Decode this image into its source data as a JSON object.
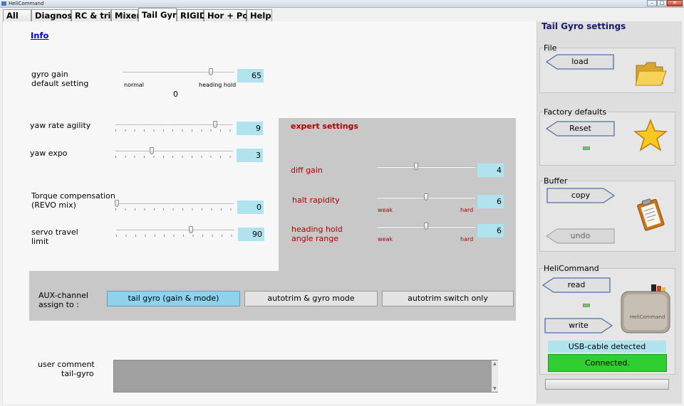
{
  "window": {
    "title": "HeliCommand"
  },
  "tabs": [
    {
      "label": "All"
    },
    {
      "label": "Diagnose"
    },
    {
      "label": "RC & trim"
    },
    {
      "label": "Mixer"
    },
    {
      "label": "Tail Gyro"
    },
    {
      "label": "RIGID"
    },
    {
      "label": "Hor + Pos"
    },
    {
      "label": "Help"
    }
  ],
  "main": {
    "info_link": "Info",
    "gyro_gain": {
      "label1": "gyro gain",
      "label2": "default setting",
      "value": "65",
      "min_label": "normal",
      "max_label": "heading hold",
      "secondary_value": "0",
      "position": 0.79
    },
    "yaw_rate": {
      "label": "yaw rate agility",
      "value": "9",
      "position": 0.85
    },
    "yaw_expo": {
      "label": "yaw expo",
      "value": "3",
      "position": 0.31
    },
    "torque": {
      "label1": "Torque  compensation",
      "label2": "(REVO mix)",
      "value": "0",
      "position": 0.01
    },
    "servo_travel": {
      "label1": "servo  travel",
      "label2": "limit",
      "value": "90",
      "position": 0.63
    },
    "expert": {
      "title": "expert settings",
      "diff_gain": {
        "label": "diff gain",
        "value": "4",
        "position": 0.4
      },
      "halt_rapidity": {
        "label": "halt rapidity",
        "value": "6",
        "min_label": "weak",
        "max_label": "hard",
        "position": 0.5
      },
      "heading_hold": {
        "label1": "heading hold",
        "label2": "angle range",
        "value": "6",
        "min_label": "weak",
        "max_label": "hard",
        "position": 0.5
      }
    },
    "aux": {
      "label1": "AUX-channel",
      "label2": "assign to :",
      "options": [
        "tail gyro (gain & mode)",
        "autotrim & gyro mode",
        "autotrim switch only"
      ],
      "selected": 0
    },
    "comment": {
      "label1": "user comment",
      "label2": "tail-gyro",
      "value": ""
    }
  },
  "sidebar": {
    "title": "Tail Gyro settings",
    "file": {
      "title": "File",
      "load_label": "load",
      "icon": "folder-icon"
    },
    "factory": {
      "title": "Factory defaults",
      "reset_label": "Reset",
      "icon": "star-icon"
    },
    "buffer": {
      "title": "Buffer",
      "copy_label": "copy",
      "undo_label": "undo",
      "icon": "clipboard-icon"
    },
    "helicommand": {
      "title": "HeliCommand",
      "read_label": "read",
      "write_label": "write",
      "icon": "device-icon"
    },
    "usb_status": "USB-cable detected",
    "connection_status": "Connected.",
    "colors": {
      "accent": "#8fd2ec",
      "value_box": "#b1e3ee",
      "connected": "#30ce30",
      "expert_text": "#b00000",
      "title": "#1a1a6e"
    }
  }
}
